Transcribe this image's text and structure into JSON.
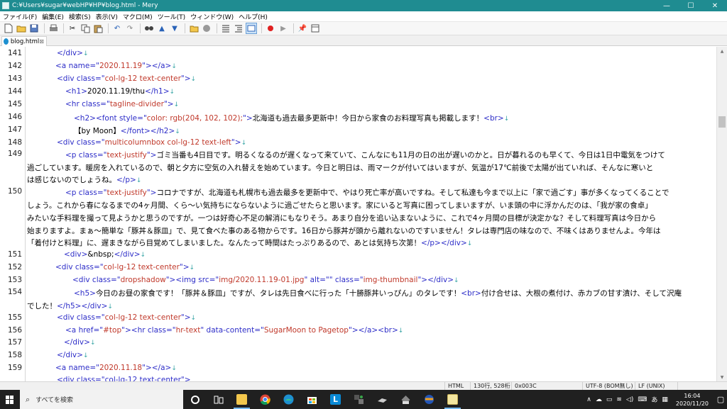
{
  "window": {
    "title": "C:¥Users¥sugar¥webHP¥HP¥blog.html - Mery",
    "minimize": "—",
    "maximize": "☐",
    "close": "✕"
  },
  "menu": [
    "ファイル(F)",
    "編集(E)",
    "検索(S)",
    "表示(V)",
    "マクロ(M)",
    "ツール(T)",
    "ウィンドウ(W)",
    "ヘルプ(H)"
  ],
  "toolbar_icons": [
    "new-file-icon",
    "open-folder-icon",
    "save-icon",
    "print-icon",
    "cut-icon",
    "copy-icon",
    "paste-icon",
    "undo-icon",
    "redo-icon",
    "find-icon",
    "find-prev-icon",
    "find-next-icon",
    "bookmark-icon",
    "marker-icon",
    "wrap-icon",
    "indent-icon",
    "view-icon",
    "record-macro-icon",
    "play-macro-icon",
    "pin-icon",
    "window-icon"
  ],
  "tab": {
    "label": "blog.html",
    "close": "⊠"
  },
  "line_numbers": [
    "141",
    "142",
    "143",
    "144",
    "145",
    "146",
    "147",
    "148",
    "149",
    "150",
    "151",
    "152",
    "153",
    "154",
    "155",
    "156",
    "157",
    "158",
    "159"
  ],
  "code": {
    "l141": "</div>",
    "l142a": "<a name=\"",
    "l142v": "2020.11.19",
    "l142b": "\"></a>",
    "l143a": "<div class=\"",
    "l143v": "col-lg-12 text-center",
    "l143b": "\">",
    "l144a": "<h1>",
    "l144t": "2020.11.19/thu",
    "l144b": "</h1>",
    "l145a": "<hr class=\"",
    "l145v": "tagline-divider",
    "l145b": "\">",
    "l146a": "<h2>",
    "l146b": "<font style=\"",
    "l146v": "color: rgb(204, 102, 102);",
    "l146c": "\">",
    "l146t": "北海道も過去最多更新中！今日から家食のお料理写真も掲載します！",
    "l146d": "<br>",
    "l147t": "【by Moon】",
    "l147a": "</font></h2>",
    "l148a": "<div class=\"",
    "l148v": "multicolumnbox col-lg-12 text-left",
    "l148b": "\">",
    "l149a": "<p class=\"",
    "l149v": "text-justify",
    "l149b": "\">",
    "l149t1": "ゴミ当番も4日目です。明るくなるのが遅くなって来ていて、こんなにも11月の日の出が遅いのかと。日が暮れるのも早くて、今日は1日中電気をつけて",
    "l149t2": "過ごしています。暖房を入れているので、朝と夕方に空気の入れ替えを始めています。今日と明日は、雨マークが付いてはいますが、気温が17℃前後で太陽が出ていれば、そんなに寒いと",
    "l149t3": "は感じないのでしょうね。",
    "l149c": "</p>",
    "l150a": "<p class=\"",
    "l150v": "text-justify",
    "l150b": "\">",
    "l150t1": "コロナですが、北海道も札幌市も過去最多を更新中で、やはり死亡率が高いですね。そして私達も今まで以上に「家で過ごす」事が多くなってくることで",
    "l150t2": "しょう。これから春になるまでの4ヶ月間、くら～い気持ちにならないように過ごせたらと思います。家にいると写真に困ってしまいますが、いま頭の中に浮かんだのは、「我が家の食卓」",
    "l150t3": "みたいな手料理を撮って見ようかと思うのですが。一つは好奇心不足の解消にもなりそう。あまり自分を追い込まないように、これで4ヶ月間の目標が決定かな？そして料理写真は今日から",
    "l150t4": "始まりますよ。まぁ～簡単な「豚丼＆豚皿」で、見て食べた事のある物からです。16日から豚丼が頭から離れないのですいません！タレは専門店の味なので、不味くはありませんよ。今年は",
    "l150t5": "「着付けと料理」に、遅まきながら目覚めてしまいました。なんたって時間はたっぷりあるので、あとは気持ち次第！",
    "l150c": "</p></div>",
    "l151a": "<div>",
    "l151t": "&nbsp;",
    "l151b": "</div>",
    "l152a": "<div class=\"",
    "l152v": "col-lg-12 text-center",
    "l152b": "\">",
    "l153a": "<div class=\"",
    "l153v": "dropshadow",
    "l153b": "\">",
    "l153c": "<img src=\"",
    "l153v2": "img/2020.11.19-01.jpg",
    "l153d": "\" alt=\"",
    "l153v3": "",
    "l153e": "\" class=\"",
    "l153v4": "img-thumbnail",
    "l153f": "\">",
    "l153g": "</div>",
    "l154a": "<h5>",
    "l154t1": "今日のお昼の家食です！「豚丼＆豚皿」ですが、タレは先日食べに行った「十勝豚丼いっぴん」のタレです！",
    "l154b": "<br>",
    "l154t2": "付け合せは、大根の煮付け、赤カブの甘す漬け、そして沢庵",
    "l154t3": "でした！",
    "l154c": "</h5></div>",
    "l155a": "<div class=\"",
    "l155v": "col-lg-12 text-center",
    "l155b": "\">",
    "l156a": "<a href=\"",
    "l156v": "#top",
    "l156b": "\">",
    "l156c": "<hr class=\"",
    "l156v2": "hr-text",
    "l156d": "\" data-content=\"",
    "l156v3": "SugarMoon to Pagetop",
    "l156e": "\">",
    "l156f": "</a><br>",
    "l157": "</div>",
    "l158": "</div>",
    "l159a": "<a name=\"",
    "l159v": "2020.11.18",
    "l159b": "\"></a>",
    "l160": "<div class=\"col-lg-12 text-center\">",
    "nl": "↓"
  },
  "status": {
    "mode": "HTML",
    "position": "130行, 528桁",
    "char_code": "0x003C",
    "encoding": "UTF-8 (BOM無し)",
    "line_ending": "LF (UNIX)"
  },
  "taskbar": {
    "search_placeholder": "すべてを検索",
    "tray_ime": "あ",
    "time": "16:04",
    "date": "2020/11/20"
  },
  "colors": {
    "titlebar": "#1f8c91",
    "tag": "#2d2dc8",
    "value": "#c0392b",
    "newline_mark": "#3aa6a6"
  }
}
